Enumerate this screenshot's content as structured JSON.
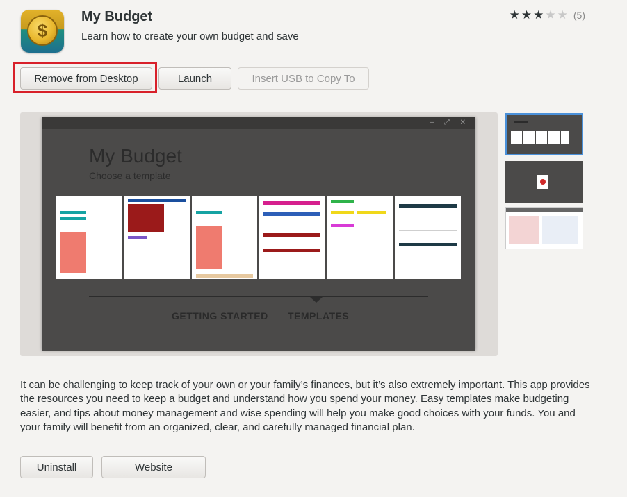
{
  "app": {
    "name": "My Budget",
    "summary": "Learn how to create your own budget and save",
    "icon": "coin-dollar-icon",
    "rating": {
      "stars_filled": 3,
      "stars_total": 5,
      "count": "(5)"
    }
  },
  "actions": {
    "remove": "Remove from Desktop",
    "launch": "Launch",
    "usb": "Insert USB to Copy To"
  },
  "screenshot": {
    "title": "My Budget",
    "subtitle": "Choose a template",
    "tab_getting_started": "GETTING STARTED",
    "tab_templates": "TEMPLATES"
  },
  "description": "It can be challenging to keep track of your own or your family’s finances, but it’s also extremely important. This app provides the resources you need to keep a budget and understand how you spend your money. Easy templates make budgeting easier, and tips about money management and wise spending will help you make good choices with your funds. You and your family will benefit from an organized, clear, and carefully managed financial plan.",
  "footer": {
    "uninstall": "Uninstall",
    "website": "Website"
  },
  "colors": {
    "highlight": "#d8202a",
    "selected_thumb": "#4a90d9"
  }
}
